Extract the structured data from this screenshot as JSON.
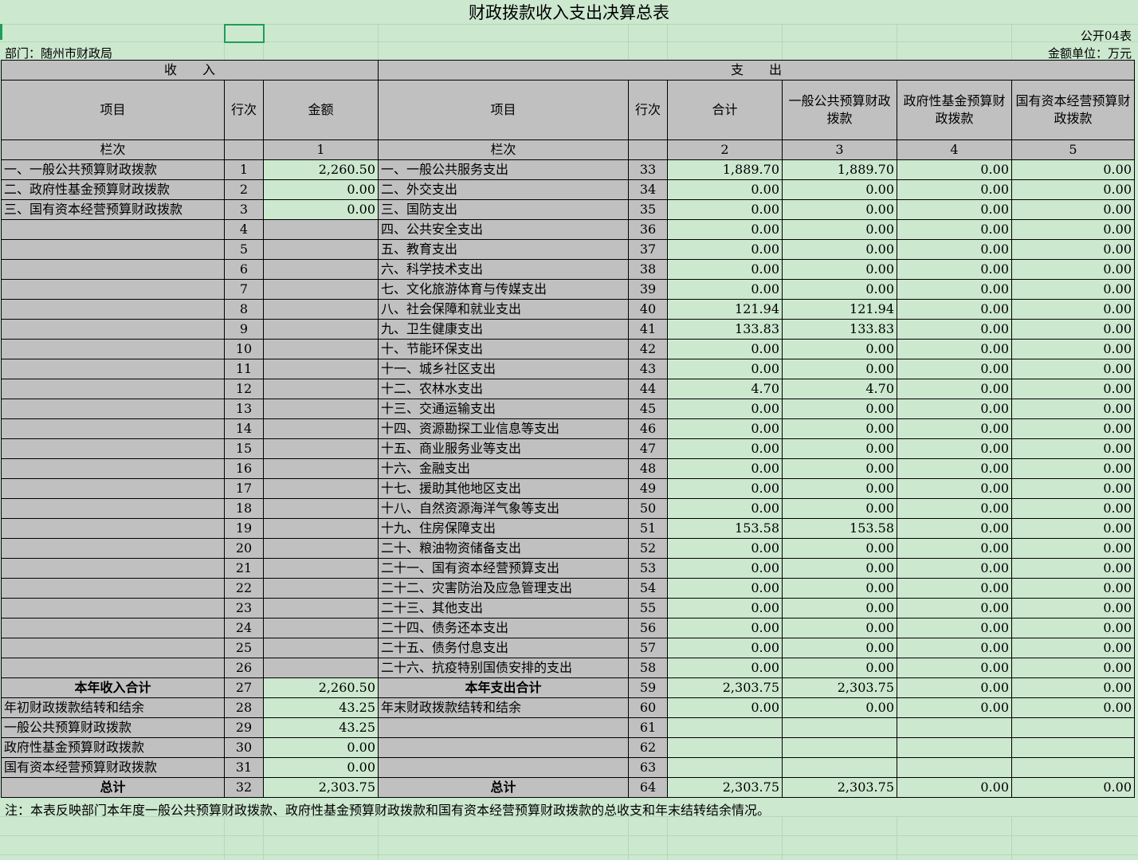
{
  "title": "财政拨款收入支出决算总表",
  "form_no": "公开04表",
  "department": "部门：随州市财政局",
  "unit": "金额单位：万元",
  "header": {
    "income_group": "收　　入",
    "expense_group": "支　　出",
    "col_item": "项目",
    "col_line": "行次",
    "col_amount": "金额",
    "col_exp_item": "项目",
    "col_exp_line": "行次",
    "col_total": "合计",
    "col_general": "一般公共预算财政拨款",
    "col_fund": "政府性基金预算财政拨款",
    "col_state": "国有资本经营预算财政拨款",
    "col_index_label": "栏次",
    "idx1": "1",
    "idx_exp_label": "栏次",
    "idx2": "2",
    "idx3": "3",
    "idx4": "4",
    "idx5": "5"
  },
  "rows": [
    {
      "in_item": "一、一般公共预算财政拨款",
      "in_line": "1",
      "in_amt": "2,260.50",
      "ex_item": "一、一般公共服务支出",
      "ex_line": "33",
      "total": "1,889.70",
      "general": "1,889.70",
      "fund": "0.00",
      "state": "0.00"
    },
    {
      "in_item": "二、政府性基金预算财政拨款",
      "in_line": "2",
      "in_amt": "0.00",
      "ex_item": "二、外交支出",
      "ex_line": "34",
      "total": "0.00",
      "general": "0.00",
      "fund": "0.00",
      "state": "0.00"
    },
    {
      "in_item": "三、国有资本经营预算财政拨款",
      "in_line": "3",
      "in_amt": "0.00",
      "ex_item": "三、国防支出",
      "ex_line": "35",
      "total": "0.00",
      "general": "0.00",
      "fund": "0.00",
      "state": "0.00"
    },
    {
      "in_item": "",
      "in_line": "4",
      "in_amt": "",
      "ex_item": "四、公共安全支出",
      "ex_line": "36",
      "total": "0.00",
      "general": "0.00",
      "fund": "0.00",
      "state": "0.00"
    },
    {
      "in_item": "",
      "in_line": "5",
      "in_amt": "",
      "ex_item": "五、教育支出",
      "ex_line": "37",
      "total": "0.00",
      "general": "0.00",
      "fund": "0.00",
      "state": "0.00"
    },
    {
      "in_item": "",
      "in_line": "6",
      "in_amt": "",
      "ex_item": "六、科学技术支出",
      "ex_line": "38",
      "total": "0.00",
      "general": "0.00",
      "fund": "0.00",
      "state": "0.00"
    },
    {
      "in_item": "",
      "in_line": "7",
      "in_amt": "",
      "ex_item": "七、文化旅游体育与传媒支出",
      "ex_line": "39",
      "total": "0.00",
      "general": "0.00",
      "fund": "0.00",
      "state": "0.00"
    },
    {
      "in_item": "",
      "in_line": "8",
      "in_amt": "",
      "ex_item": "八、社会保障和就业支出",
      "ex_line": "40",
      "total": "121.94",
      "general": "121.94",
      "fund": "0.00",
      "state": "0.00"
    },
    {
      "in_item": "",
      "in_line": "9",
      "in_amt": "",
      "ex_item": "九、卫生健康支出",
      "ex_line": "41",
      "total": "133.83",
      "general": "133.83",
      "fund": "0.00",
      "state": "0.00"
    },
    {
      "in_item": "",
      "in_line": "10",
      "in_amt": "",
      "ex_item": "十、节能环保支出",
      "ex_line": "42",
      "total": "0.00",
      "general": "0.00",
      "fund": "0.00",
      "state": "0.00"
    },
    {
      "in_item": "",
      "in_line": "11",
      "in_amt": "",
      "ex_item": "十一、城乡社区支出",
      "ex_line": "43",
      "total": "0.00",
      "general": "0.00",
      "fund": "0.00",
      "state": "0.00"
    },
    {
      "in_item": "",
      "in_line": "12",
      "in_amt": "",
      "ex_item": "十二、农林水支出",
      "ex_line": "44",
      "total": "4.70",
      "general": "4.70",
      "fund": "0.00",
      "state": "0.00"
    },
    {
      "in_item": "",
      "in_line": "13",
      "in_amt": "",
      "ex_item": "十三、交通运输支出",
      "ex_line": "45",
      "total": "0.00",
      "general": "0.00",
      "fund": "0.00",
      "state": "0.00"
    },
    {
      "in_item": "",
      "in_line": "14",
      "in_amt": "",
      "ex_item": "十四、资源勘探工业信息等支出",
      "ex_line": "46",
      "total": "0.00",
      "general": "0.00",
      "fund": "0.00",
      "state": "0.00"
    },
    {
      "in_item": "",
      "in_line": "15",
      "in_amt": "",
      "ex_item": "十五、商业服务业等支出",
      "ex_line": "47",
      "total": "0.00",
      "general": "0.00",
      "fund": "0.00",
      "state": "0.00"
    },
    {
      "in_item": "",
      "in_line": "16",
      "in_amt": "",
      "ex_item": "十六、金融支出",
      "ex_line": "48",
      "total": "0.00",
      "general": "0.00",
      "fund": "0.00",
      "state": "0.00"
    },
    {
      "in_item": "",
      "in_line": "17",
      "in_amt": "",
      "ex_item": "十七、援助其他地区支出",
      "ex_line": "49",
      "total": "0.00",
      "general": "0.00",
      "fund": "0.00",
      "state": "0.00"
    },
    {
      "in_item": "",
      "in_line": "18",
      "in_amt": "",
      "ex_item": "十八、自然资源海洋气象等支出",
      "ex_line": "50",
      "total": "0.00",
      "general": "0.00",
      "fund": "0.00",
      "state": "0.00"
    },
    {
      "in_item": "",
      "in_line": "19",
      "in_amt": "",
      "ex_item": "十九、住房保障支出",
      "ex_line": "51",
      "total": "153.58",
      "general": "153.58",
      "fund": "0.00",
      "state": "0.00"
    },
    {
      "in_item": "",
      "in_line": "20",
      "in_amt": "",
      "ex_item": "二十、粮油物资储备支出",
      "ex_line": "52",
      "total": "0.00",
      "general": "0.00",
      "fund": "0.00",
      "state": "0.00"
    },
    {
      "in_item": "",
      "in_line": "21",
      "in_amt": "",
      "ex_item": "二十一、国有资本经营预算支出",
      "ex_line": "53",
      "total": "0.00",
      "general": "0.00",
      "fund": "0.00",
      "state": "0.00"
    },
    {
      "in_item": "",
      "in_line": "22",
      "in_amt": "",
      "ex_item": "二十二、灾害防治及应急管理支出",
      "ex_line": "54",
      "total": "0.00",
      "general": "0.00",
      "fund": "0.00",
      "state": "0.00"
    },
    {
      "in_item": "",
      "in_line": "23",
      "in_amt": "",
      "ex_item": "二十三、其他支出",
      "ex_line": "55",
      "total": "0.00",
      "general": "0.00",
      "fund": "0.00",
      "state": "0.00"
    },
    {
      "in_item": "",
      "in_line": "24",
      "in_amt": "",
      "ex_item": "二十四、债务还本支出",
      "ex_line": "56",
      "total": "0.00",
      "general": "0.00",
      "fund": "0.00",
      "state": "0.00"
    },
    {
      "in_item": "",
      "in_line": "25",
      "in_amt": "",
      "ex_item": "二十五、债务付息支出",
      "ex_line": "57",
      "total": "0.00",
      "general": "0.00",
      "fund": "0.00",
      "state": "0.00"
    },
    {
      "in_item": "",
      "in_line": "26",
      "in_amt": "",
      "ex_item": "二十六、抗疫特别国债安排的支出",
      "ex_line": "58",
      "total": "0.00",
      "general": "0.00",
      "fund": "0.00",
      "state": "0.00"
    }
  ],
  "subtotal": {
    "in_item": "本年收入合计",
    "in_line": "27",
    "in_amt": "2,260.50",
    "ex_item": "本年支出合计",
    "ex_line": "59",
    "total": "2,303.75",
    "general": "2,303.75",
    "fund": "0.00",
    "state": "0.00"
  },
  "carry": [
    {
      "in_item": "年初财政拨款结转和结余",
      "in_line": "28",
      "in_amt": "43.25",
      "ex_item": "年末财政拨款结转和结余",
      "ex_line": "60",
      "total": "0.00",
      "general": "0.00",
      "fund": "0.00",
      "state": "0.00"
    },
    {
      "in_item": "一般公共预算财政拨款",
      "in_line": "29",
      "in_amt": "43.25",
      "ex_item": "",
      "ex_line": "61",
      "total": "",
      "general": "",
      "fund": "",
      "state": ""
    },
    {
      "in_item": "政府性基金预算财政拨款",
      "in_line": "30",
      "in_amt": "0.00",
      "ex_item": "",
      "ex_line": "62",
      "total": "",
      "general": "",
      "fund": "",
      "state": ""
    },
    {
      "in_item": "国有资本经营预算财政拨款",
      "in_line": "31",
      "in_amt": "0.00",
      "ex_item": "",
      "ex_line": "63",
      "total": "",
      "general": "",
      "fund": "",
      "state": ""
    }
  ],
  "grand_total": {
    "in_item": "总计",
    "in_line": "32",
    "in_amt": "2,303.75",
    "ex_item": "总计",
    "ex_line": "64",
    "total": "2,303.75",
    "general": "2,303.75",
    "fund": "0.00",
    "state": "0.00"
  },
  "note": "注：本表反映部门本年度一般公共预算财政拨款、政府性基金预算财政拨款和国有资本经营预算财政拨款的总收支和年末结转结余情况。",
  "colors": {
    "sheet_bg": "#cce8cf",
    "header_gray": "#c0c0c0",
    "selection": "#1f9d57"
  }
}
